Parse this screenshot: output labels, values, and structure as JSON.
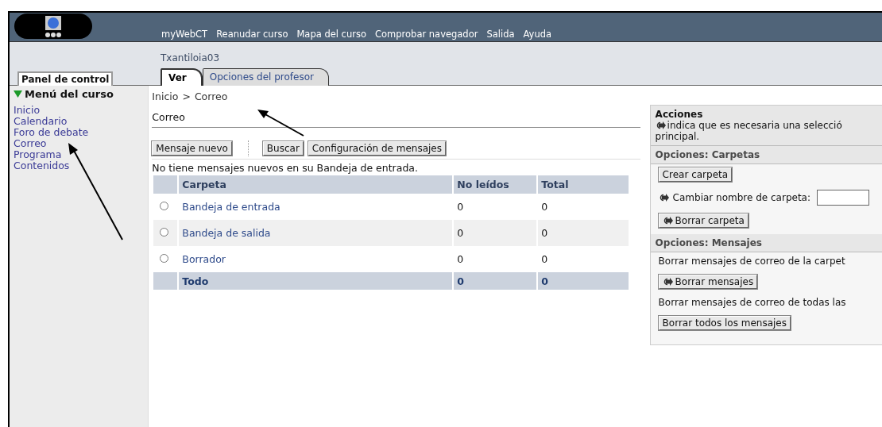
{
  "top_nav": {
    "items": [
      "myWebCT",
      "Reanudar curso",
      "Mapa del curso",
      "Comprobar navegador",
      "Salida",
      "Ayuda"
    ]
  },
  "course_name": "Txantiloia03",
  "control_panel_tab": "Panel de control",
  "tabs": [
    {
      "label": "Ver",
      "selected": true
    },
    {
      "label": "Opciones del profesor",
      "selected": false
    }
  ],
  "sidebar": {
    "title": "Menú del curso",
    "expanded": true,
    "items": [
      "Inicio",
      "Calendario",
      "Foro de debate",
      "Correo",
      "Programa",
      "Contenidos"
    ]
  },
  "breadcrumb": {
    "items": [
      "Inicio",
      "Correo"
    ],
    "separator": ">"
  },
  "page_title": "Correo",
  "toolbar": [
    "Mensaje nuevo",
    "Buscar",
    "Configuración de mensajes"
  ],
  "message": "No tiene mensajes nuevos en su Bandeja de entrada.",
  "table": {
    "columns": [
      "Carpeta",
      "No leídos",
      "Total"
    ],
    "rows": [
      {
        "folder": "Bandeja de entrada",
        "unread": "0",
        "total": "0",
        "selected": false
      },
      {
        "folder": "Bandeja de salida",
        "unread": "0",
        "total": "0",
        "selected": false
      },
      {
        "folder": "Borrador",
        "unread": "0",
        "total": "0",
        "selected": false
      }
    ],
    "total_row": {
      "label": "Todo",
      "unread": "0",
      "total": "0"
    }
  },
  "actions": {
    "title": "Acciones",
    "note_line1": "indica que es necesaria una selecció",
    "note_line2": "principal.",
    "sections": [
      {
        "title": "Opciones: Carpetas",
        "items": [
          {
            "kind": "button",
            "label": "Crear carpeta",
            "requires_selection": false
          },
          {
            "kind": "field",
            "label": "Cambiar nombre de carpeta:",
            "requires_selection": true
          },
          {
            "kind": "button",
            "label": "Borrar carpeta",
            "requires_selection": true
          }
        ]
      },
      {
        "title": "Opciones: Mensajes",
        "items": [
          {
            "kind": "text",
            "label": "Borrar mensajes de correo de la carpet"
          },
          {
            "kind": "button",
            "label": "Borrar mensajes",
            "requires_selection": true
          },
          {
            "kind": "text",
            "label": "Borrar mensajes de correo de todas las"
          },
          {
            "kind": "button",
            "label": "Borrar todos los mensajes",
            "requires_selection": false
          }
        ]
      }
    ]
  }
}
